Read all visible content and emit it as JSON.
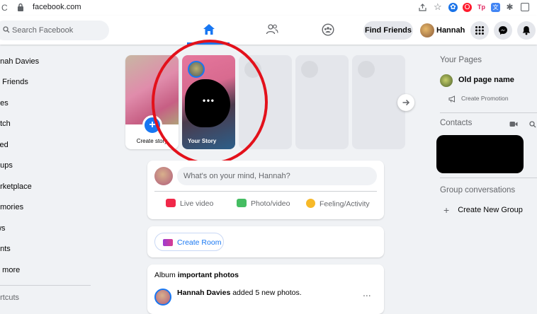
{
  "browser": {
    "url": "facebook.com"
  },
  "header": {
    "search_placeholder": "Search Facebook",
    "find_friends": "Find Friends",
    "profile_name": "Hannah"
  },
  "left_nav": {
    "items": [
      "nnah Davies",
      "d Friends",
      "ges",
      "atch",
      "ved",
      "oups",
      "arketplace",
      "emories",
      "ws",
      "ents",
      "e more"
    ],
    "shortcuts": "ortcuts"
  },
  "stories": {
    "create_label": "Create story",
    "your_story_label": "Your Story",
    "your_story_dots": "ꔷꔷꔷ"
  },
  "composer": {
    "placeholder": "What's on your mind, Hannah?",
    "live_video": "Live video",
    "photo_video": "Photo/video",
    "feeling": "Feeling/Activity"
  },
  "room": {
    "create_room": "Create Room"
  },
  "post": {
    "album_prefix": "Album ",
    "album_name": "important photos",
    "author": "Hannah Davies",
    "action": " added 5 new photos.",
    "more": "..."
  },
  "right": {
    "your_pages": "Your Pages",
    "page_name": "Old page name",
    "create_promotion": "Create Promotion",
    "contacts": "Contacts",
    "group_conversations": "Group conversations",
    "create_new_group": "Create New Group"
  },
  "colors": {
    "brand_blue": "#1877f2",
    "annotation_red": "#e3111b"
  }
}
